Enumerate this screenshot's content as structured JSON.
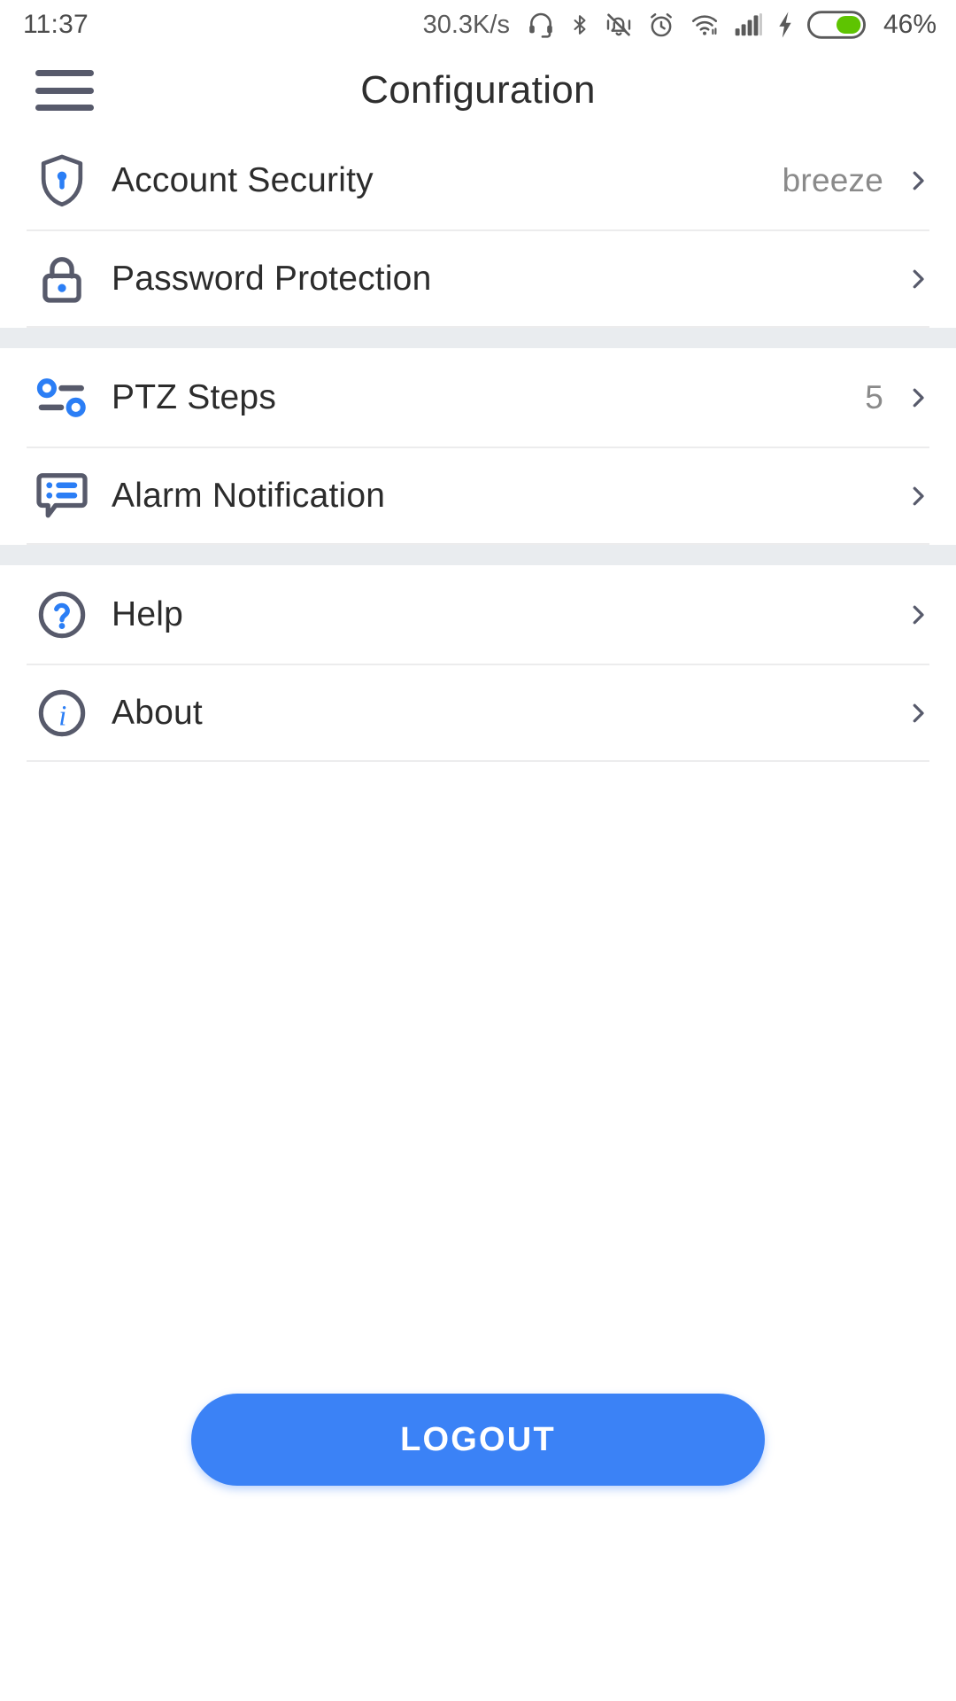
{
  "status_bar": {
    "time": "11:37",
    "network_speed": "30.3K/s",
    "battery_percent": "46%",
    "icons": [
      "headset-icon",
      "bluetooth-icon",
      "vibrate-off-icon",
      "alarm-clock-icon",
      "wifi-icon",
      "cellular-signal-icon",
      "charging-bolt-icon",
      "battery-icon"
    ]
  },
  "header": {
    "menu_icon": "hamburger-menu-icon",
    "title": "Configuration"
  },
  "groups": [
    {
      "rows": [
        {
          "icon": "shield-key-icon",
          "label": "Account Security",
          "value": "breeze",
          "chevron": "chevron-right-icon"
        },
        {
          "icon": "lock-icon",
          "label": "Password Protection",
          "value": "",
          "chevron": "chevron-right-icon"
        }
      ]
    },
    {
      "rows": [
        {
          "icon": "tune-sliders-icon",
          "label": "PTZ Steps",
          "value": "5",
          "chevron": "chevron-right-icon"
        },
        {
          "icon": "chat-bubble-list-icon",
          "label": "Alarm Notification",
          "value": "",
          "chevron": "chevron-right-icon"
        }
      ]
    },
    {
      "rows": [
        {
          "icon": "help-circle-icon",
          "label": "Help",
          "value": "",
          "chevron": "chevron-right-icon"
        },
        {
          "icon": "info-circle-icon",
          "label": "About",
          "value": "",
          "chevron": "chevron-right-icon"
        }
      ]
    }
  ],
  "logout": {
    "label": "LOGOUT"
  },
  "colors": {
    "accent_blue": "#3b82f6",
    "icon_gray": "#575a6b",
    "text_primary": "#2c2c2c",
    "text_secondary": "#8a8a8a",
    "divider": "#ececed",
    "section_gap": "#e9ecef",
    "battery_green": "#5ec401"
  }
}
